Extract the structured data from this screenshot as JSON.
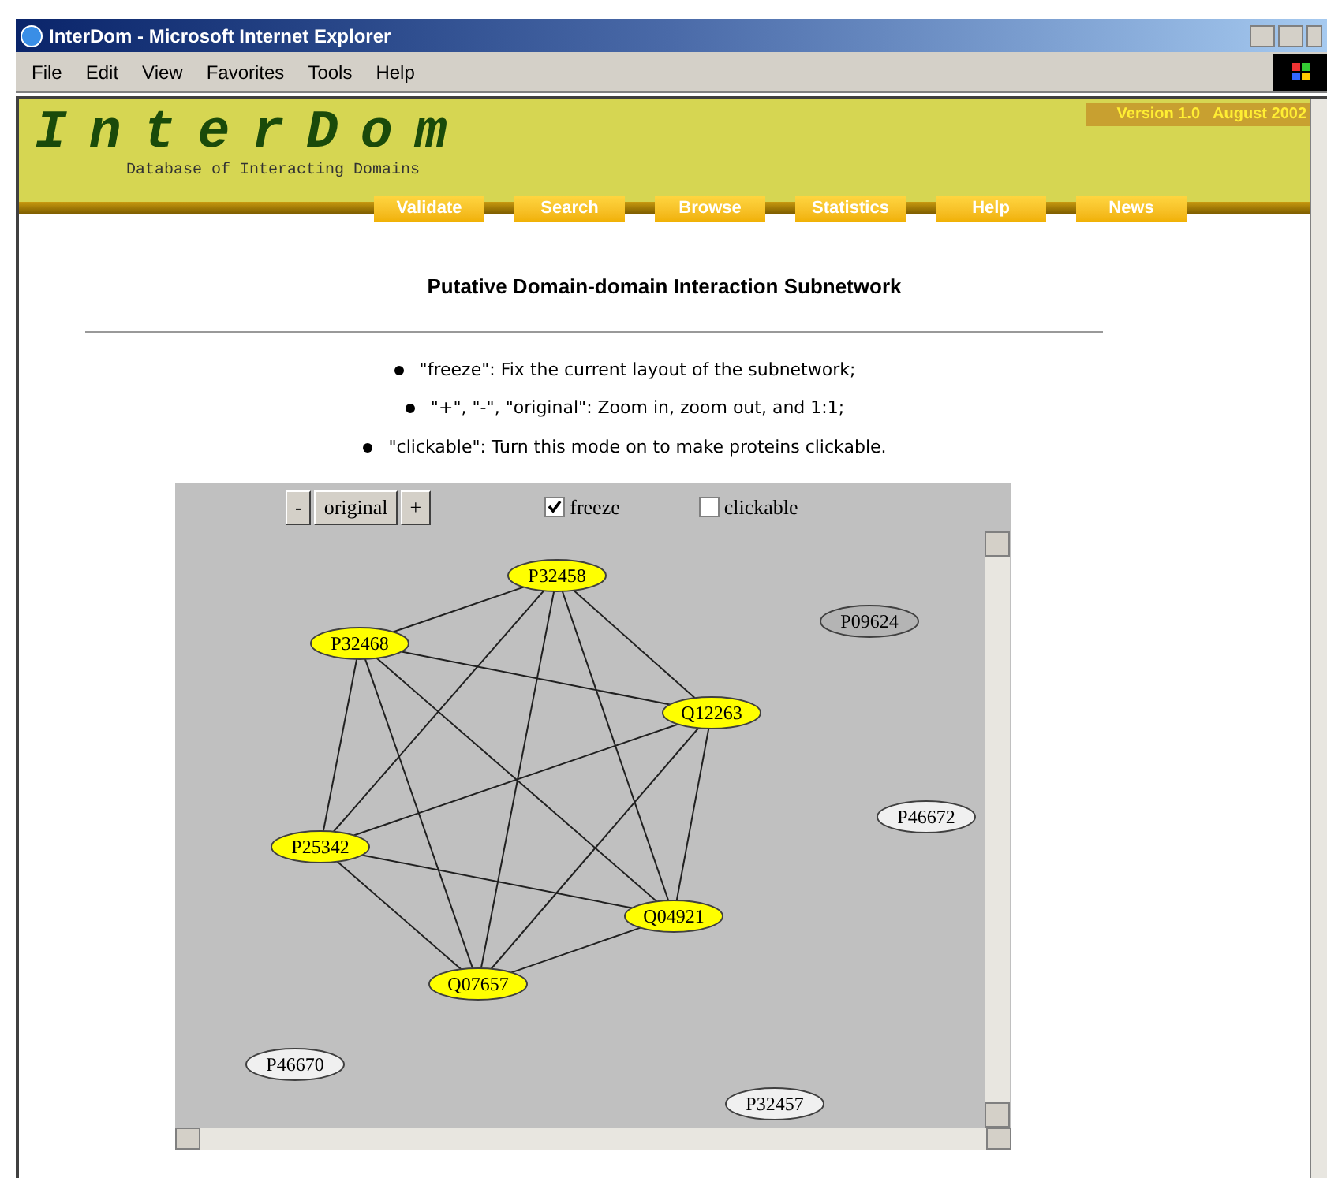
{
  "window": {
    "title": "InterDom - Microsoft Internet Explorer"
  },
  "menu": [
    "File",
    "Edit",
    "View",
    "Favorites",
    "Tools",
    "Help"
  ],
  "site": {
    "logo": "InterDom",
    "tagline": "Database of Interacting Domains",
    "version": "Version 1.0   August 2002"
  },
  "nav": [
    "Validate",
    "Search",
    "Browse",
    "Statistics",
    "Help",
    "News"
  ],
  "heading": "Putative Domain-domain Interaction Subnetwork",
  "notes": [
    "\"freeze\": Fix the current layout of the subnetwork;",
    "\"+\", \"-\", \"original\": Zoom in, zoom out, and 1:1;",
    "\"clickable\": Turn this mode on to make proteins clickable."
  ],
  "toolbar": {
    "buttons": [
      "-",
      "original",
      "+"
    ],
    "checkboxes": [
      {
        "label": "freeze",
        "checked": true
      },
      {
        "label": "clickable",
        "checked": false
      }
    ]
  },
  "graph": {
    "nodes": [
      {
        "label": "P32458",
        "color": "#ffff00"
      },
      {
        "label": "P32468",
        "color": "#ffff00"
      },
      {
        "label": "Q12263",
        "color": "#ffff00"
      },
      {
        "label": "P25342",
        "color": "#ffff00"
      },
      {
        "label": "Q04921",
        "color": "#ffff00"
      },
      {
        "label": "Q07657",
        "color": "#ffff00"
      },
      {
        "label": "P09624",
        "color": "#b4b4b4"
      },
      {
        "label": "P46672",
        "color": "#f0f0f0"
      },
      {
        "label": "P46670",
        "color": "#f0f0f0"
      },
      {
        "label": "P32457",
        "color": "#f0f0f0"
      }
    ]
  }
}
